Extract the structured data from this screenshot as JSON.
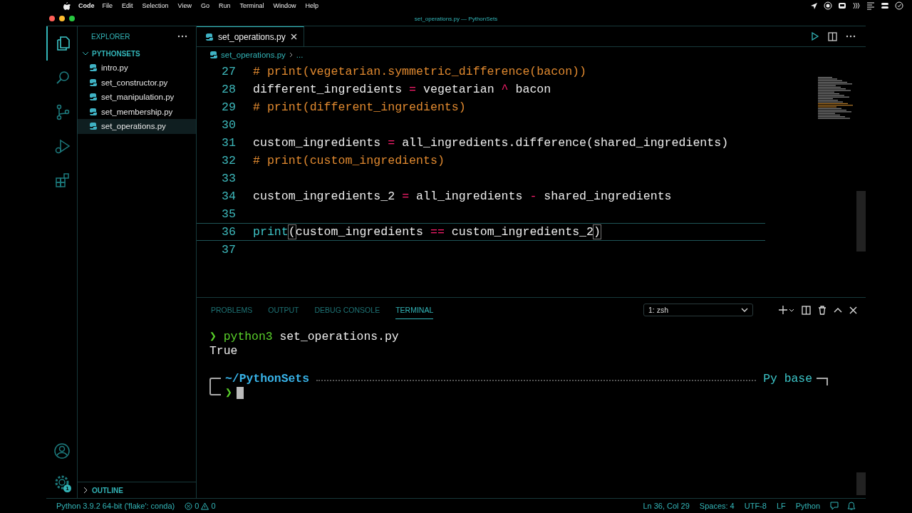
{
  "menu_bar": {
    "app_name": "Code",
    "items": [
      "File",
      "Edit",
      "Selection",
      "View",
      "Go",
      "Run",
      "Terminal",
      "Window",
      "Help"
    ]
  },
  "window": {
    "title": "set_operations.py — PythonSets"
  },
  "activity_bar": {
    "items": [
      {
        "kind": "files",
        "selected": true
      },
      {
        "kind": "search",
        "selected": false
      },
      {
        "kind": "source-control",
        "selected": false
      },
      {
        "kind": "run",
        "selected": false
      },
      {
        "kind": "extensions",
        "selected": false
      }
    ],
    "settings_badge": "1"
  },
  "sidebar": {
    "title": "EXPLORER",
    "folder": {
      "name": "PYTHONSETS",
      "expanded": true,
      "children": [
        {
          "name": "intro.py",
          "selected": false
        },
        {
          "name": "set_constructor.py",
          "selected": false
        },
        {
          "name": "set_manipulation.py",
          "selected": false
        },
        {
          "name": "set_membership.py",
          "selected": false
        },
        {
          "name": "set_operations.py",
          "selected": true
        }
      ]
    },
    "outline": {
      "label": "OUTLINE",
      "expanded": false
    }
  },
  "editor": {
    "tabs": [
      {
        "label": "set_operations.py",
        "selected": true
      }
    ],
    "breadcrumb": [
      "set_operations.py",
      "..."
    ],
    "lines": [
      {
        "number": "27",
        "current": false,
        "tokens": [
          {
            "kind": "comment",
            "text": "# print(vegetarian.symmetric_difference(bacon))"
          }
        ]
      },
      {
        "number": "28",
        "current": false,
        "tokens": [
          {
            "kind": "plain",
            "text": "different_ingredients "
          },
          {
            "kind": "op",
            "text": "="
          },
          {
            "kind": "plain",
            "text": " vegetarian "
          },
          {
            "kind": "op",
            "text": "^"
          },
          {
            "kind": "plain",
            "text": " bacon"
          }
        ]
      },
      {
        "number": "29",
        "current": false,
        "tokens": [
          {
            "kind": "comment",
            "text": "# print(different_ingredients)"
          }
        ]
      },
      {
        "number": "30",
        "current": false
      },
      {
        "number": "31",
        "current": false,
        "tokens": [
          {
            "kind": "plain",
            "text": "custom_ingredients "
          },
          {
            "kind": "op",
            "text": "="
          },
          {
            "kind": "plain",
            "text": " all_ingredients.difference(shared_ingredients)"
          }
        ]
      },
      {
        "number": "32",
        "current": false,
        "tokens": [
          {
            "kind": "comment",
            "text": "# print(custom_ingredients)"
          }
        ]
      },
      {
        "number": "33",
        "current": false
      },
      {
        "number": "34",
        "current": false,
        "tokens": [
          {
            "kind": "plain",
            "text": "custom_ingredients_2 "
          },
          {
            "kind": "op",
            "text": "="
          },
          {
            "kind": "plain",
            "text": " all_ingredients "
          },
          {
            "kind": "op",
            "text": "-"
          },
          {
            "kind": "plain",
            "text": " shared_ingredients"
          }
        ]
      },
      {
        "number": "35",
        "current": false
      },
      {
        "number": "36",
        "current": true,
        "tokens": [
          {
            "kind": "builtin",
            "text": "print"
          },
          {
            "kind": "bracket",
            "text": "("
          },
          {
            "kind": "plain",
            "text": "custom_ingredients "
          },
          {
            "kind": "op",
            "text": "=="
          },
          {
            "kind": "plain",
            "text": " custom_ingredients_2"
          },
          {
            "kind": "bracket",
            "text": ")"
          }
        ]
      },
      {
        "number": "37",
        "current": false
      }
    ]
  },
  "panel": {
    "tabs": [
      {
        "label": "PROBLEMS",
        "selected": false
      },
      {
        "label": "OUTPUT",
        "selected": false
      },
      {
        "label": "DEBUG CONSOLE",
        "selected": false
      },
      {
        "label": "TERMINAL",
        "selected": true
      }
    ],
    "terminal_select": "1: zsh",
    "terminal": {
      "prompt_symbol": "❯",
      "command_name": "python3",
      "command_args": "set_operations.py",
      "output": "True",
      "path": "~/PythonSets",
      "env": "Py base",
      "input_prompt": "❯"
    }
  },
  "status_bar": {
    "interpreter": "Python 3.9.2 64-bit ('flake': conda)",
    "errors": "0",
    "warnings": "0",
    "right": [
      "Ln 36, Col 29",
      "Spaces: 4",
      "UTF-8",
      "LF",
      "Python"
    ]
  }
}
